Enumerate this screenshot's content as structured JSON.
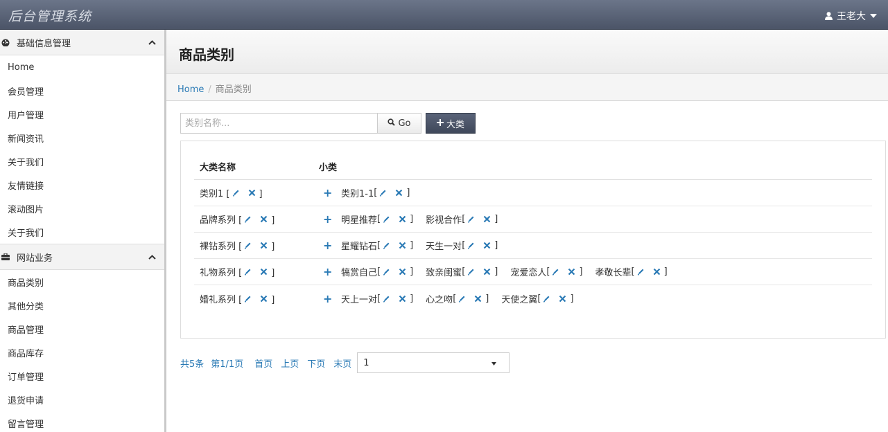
{
  "app": {
    "title": "后台管理系统",
    "user": "王老大"
  },
  "sidebar": {
    "groups": [
      {
        "label": "基础信息管理",
        "items": [
          "Home",
          "会员管理",
          "用户管理",
          "新闻资讯",
          "关于我们",
          "友情链接",
          "滚动图片",
          "关于我们"
        ]
      },
      {
        "label": "网站业务",
        "items": [
          "商品类别",
          "其他分类",
          "商品管理",
          "商品库存",
          "订单管理",
          "退货申请",
          "留言管理"
        ]
      }
    ]
  },
  "page": {
    "title": "商品类别"
  },
  "breadcrumb": {
    "home": "Home",
    "sep": "/",
    "current": "商品类别"
  },
  "search": {
    "placeholder": "类别名称...",
    "go_label": "Go",
    "add_label": "大类"
  },
  "table": {
    "headers": [
      "大类名称",
      "小类"
    ],
    "rows": [
      {
        "name": "类别1",
        "subs": [
          "类别1-1"
        ]
      },
      {
        "name": "品牌系列",
        "subs": [
          "明星推荐",
          "影视合作"
        ]
      },
      {
        "name": "裸钻系列",
        "subs": [
          "星耀钻石",
          "天生一对"
        ]
      },
      {
        "name": "礼物系列",
        "subs": [
          "犒赏自己",
          "致亲闺蜜",
          "宠爱恋人",
          "孝敬长辈"
        ]
      },
      {
        "name": "婚礼系列",
        "subs": [
          "天上一对",
          "心之吻",
          "天使之翼"
        ]
      }
    ]
  },
  "pagination": {
    "total": "共5条",
    "pageinfo": "第1/1页",
    "first": "首页",
    "prev": "上页",
    "next": "下页",
    "last": "末页",
    "selected": "1"
  },
  "colors": {
    "link": "#2a7ab5",
    "navbar": "#4b5467"
  }
}
